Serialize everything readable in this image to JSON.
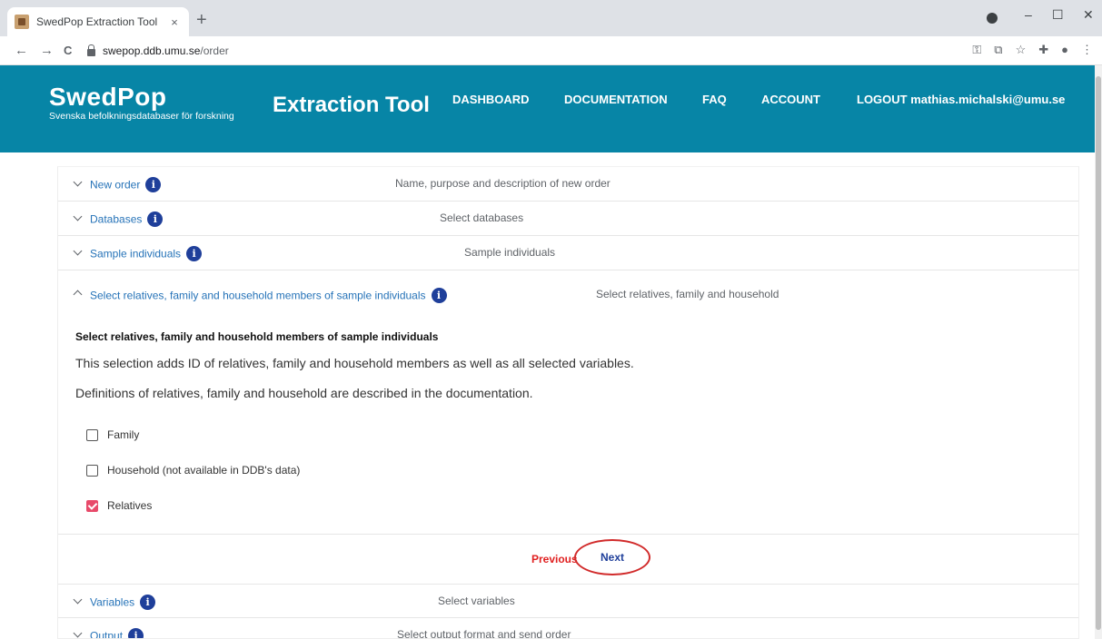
{
  "browser": {
    "tab_title": "SwedPop Extraction Tool",
    "tab_close": "×",
    "new_tab": "+",
    "url_host": "swepop.ddb.umu.se",
    "url_path": "/order",
    "win_min": "–",
    "win_max": "☐",
    "win_close": "✕",
    "back": "←",
    "forward": "→",
    "reload": "C",
    "icons": [
      "key-icon",
      "translate-icon",
      "star-icon",
      "extensions-icon",
      "profile-icon",
      "menu-icon"
    ]
  },
  "header": {
    "brand_name": "SwedPop",
    "brand_sub": "Svenska befolkningsdatabaser för forskning",
    "tool_title": "Extraction Tool",
    "nav": {
      "dashboard": "DASHBOARD",
      "documentation": "DOCUMENTATION",
      "faq": "FAQ",
      "account": "ACCOUNT",
      "logout": "LOGOUT mathias.michalski@umu.se"
    },
    "bg_color": "#0785a6"
  },
  "panels": [
    {
      "title": "New order",
      "desc": "Name, purpose and description of new order"
    },
    {
      "title": "Databases",
      "desc": "Select databases"
    },
    {
      "title": "Sample individuals",
      "desc": "Sample individuals"
    },
    {
      "title": "Select relatives, family and household members of sample individuals",
      "desc": "Select relatives, family and household"
    },
    {
      "title": "Variables",
      "desc": "Select variables"
    },
    {
      "title": "Output",
      "desc": "Select output format and send order"
    }
  ],
  "info_glyph": "i",
  "expanded": {
    "heading": "Select relatives, family and household members of sample individuals",
    "text1": "This selection adds ID of relatives, family and household members as well as all selected variables.",
    "text2": "Definitions of relatives, family and household are described in the documentation.",
    "options": [
      {
        "label": "Family",
        "checked": false
      },
      {
        "label": "Household (not available in DDB's data)",
        "checked": false
      },
      {
        "label": "Relatives",
        "checked": true
      }
    ],
    "previous_label": "Previous",
    "next_label": "Next"
  }
}
